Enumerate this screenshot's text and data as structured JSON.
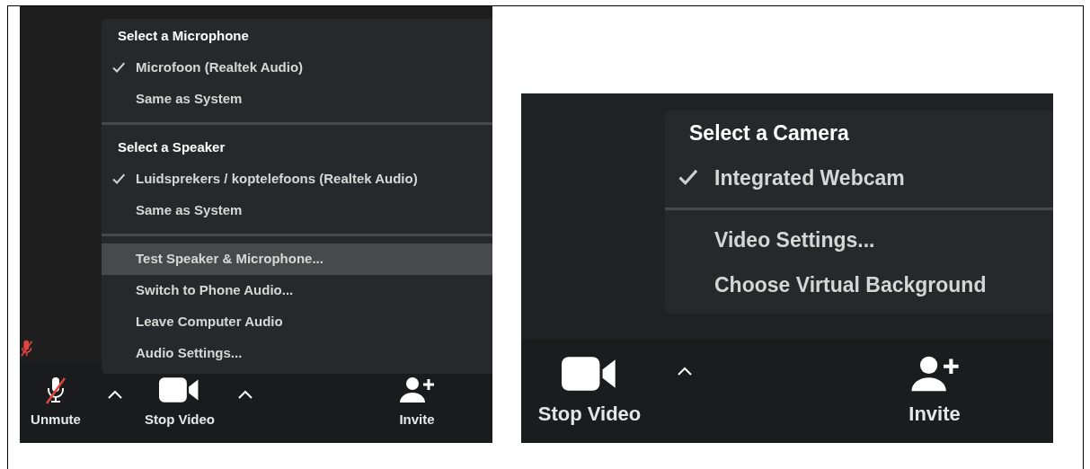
{
  "screenshots": [
    {
      "participant_muted": true,
      "menu": {
        "items": [
          {
            "kind": "header",
            "label": "Select a Microphone"
          },
          {
            "kind": "option",
            "label": "Microfoon (Realtek Audio)",
            "checked": true
          },
          {
            "kind": "option",
            "label": "Same as System",
            "checked": false
          },
          {
            "kind": "separator"
          },
          {
            "kind": "header",
            "label": "Select a Speaker"
          },
          {
            "kind": "option",
            "label": "Luidsprekers / koptelefoons (Realtek Audio)",
            "checked": true
          },
          {
            "kind": "option",
            "label": "Same as System",
            "checked": false
          },
          {
            "kind": "separator"
          },
          {
            "kind": "action",
            "label": "Test Speaker & Microphone...",
            "highlighted": true
          },
          {
            "kind": "action",
            "label": "Switch to Phone Audio...",
            "highlighted": false
          },
          {
            "kind": "action",
            "label": "Leave Computer Audio",
            "highlighted": false
          },
          {
            "kind": "action",
            "label": "Audio Settings...",
            "highlighted": false
          }
        ]
      },
      "toolbar": [
        {
          "kind": "mic-muted",
          "label": "Unmute",
          "caret": true
        },
        {
          "kind": "camera",
          "label": "Stop Video",
          "caret": true
        },
        {
          "kind": "invite",
          "label": "Invite",
          "caret": false
        }
      ]
    },
    {
      "participant_muted": false,
      "menu": {
        "items": [
          {
            "kind": "header",
            "label": "Select a Camera"
          },
          {
            "kind": "option",
            "label": "Integrated Webcam",
            "checked": true
          },
          {
            "kind": "separator"
          },
          {
            "kind": "action",
            "label": "Video Settings...",
            "highlighted": false
          },
          {
            "kind": "action",
            "label": "Choose Virtual Background",
            "highlighted": false
          }
        ]
      },
      "toolbar": [
        {
          "kind": "camera",
          "label": "Stop Video",
          "caret": true
        },
        {
          "kind": "invite",
          "label": "Invite",
          "caret": false
        }
      ]
    }
  ]
}
